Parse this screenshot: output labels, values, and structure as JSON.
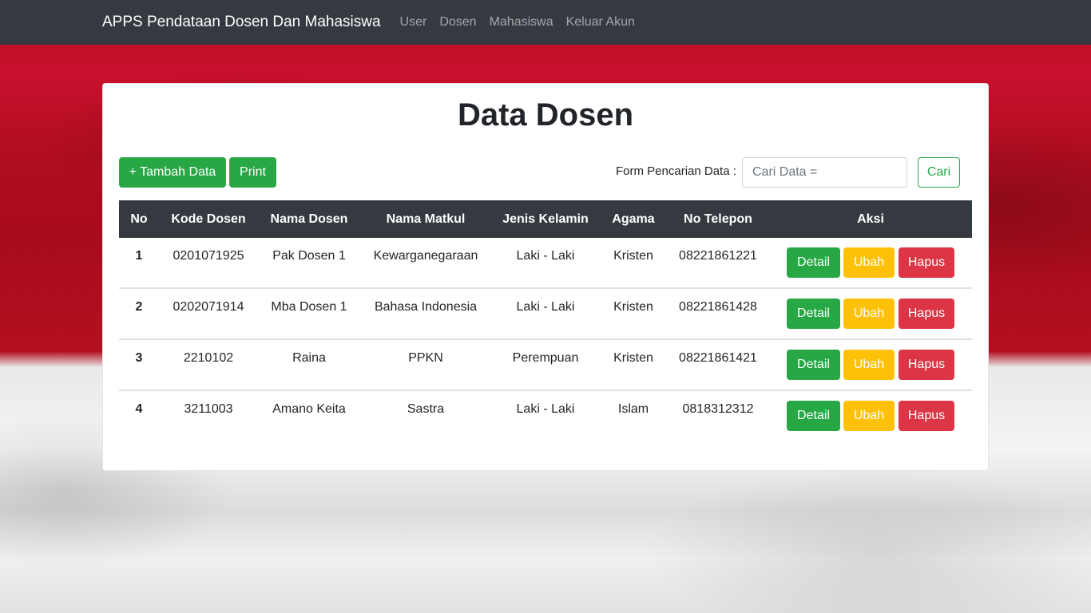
{
  "navbar": {
    "brand": "APPS Pendataan Dosen Dan Mahasiswa",
    "links": [
      "User",
      "Dosen",
      "Mahasiswa",
      "Keluar Akun"
    ]
  },
  "page": {
    "title": "Data Dosen",
    "add_button": "+ Tambah Data",
    "print_button": "Print",
    "search_label": "Form Pencarian Data :",
    "search_placeholder": "Cari Data =",
    "search_button": "Cari"
  },
  "table": {
    "headers": [
      "No",
      "Kode Dosen",
      "Nama Dosen",
      "Nama Matkul",
      "Jenis Kelamin",
      "Agama",
      "No Telepon",
      "Aksi"
    ],
    "rows": [
      {
        "no": "1",
        "kode": "0201071925",
        "nama": "Pak Dosen 1",
        "matkul": "Kewarganegaraan",
        "jk": "Laki - Laki",
        "agama": "Kristen",
        "telp": "08221861221"
      },
      {
        "no": "2",
        "kode": "0202071914",
        "nama": "Mba Dosen 1",
        "matkul": "Bahasa Indonesia",
        "jk": "Laki - Laki",
        "agama": "Kristen",
        "telp": "08221861428"
      },
      {
        "no": "3",
        "kode": "2210102",
        "nama": "Raina",
        "matkul": "PPKN",
        "jk": "Perempuan",
        "agama": "Kristen",
        "telp": "08221861421"
      },
      {
        "no": "4",
        "kode": "3211003",
        "nama": "Amano Keita",
        "matkul": "Sastra",
        "jk": "Laki - Laki",
        "agama": "Islam",
        "telp": "0818312312"
      }
    ],
    "actions": {
      "detail": "Detail",
      "ubah": "Ubah",
      "hapus": "Hapus"
    }
  },
  "colors": {
    "navbar": "#343a40",
    "success": "#28a745",
    "warning": "#ffc107",
    "danger": "#dc3545"
  }
}
